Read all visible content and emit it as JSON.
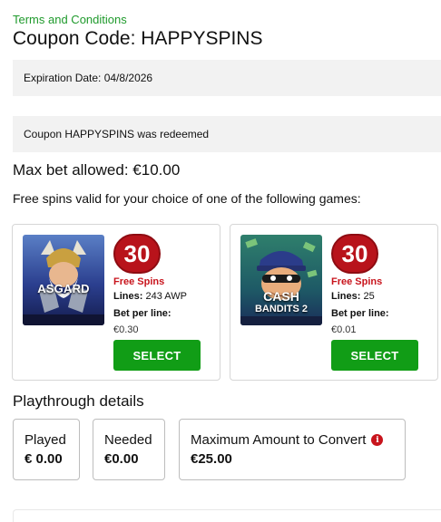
{
  "header": {
    "terms_link": "Terms and Conditions",
    "title": "Coupon Code: HAPPYSPINS"
  },
  "expiration": {
    "text": "Expiration Date: 04/8/2026"
  },
  "redeem_notice": {
    "text": "Coupon HAPPYSPINS was redeemed"
  },
  "max_bet": {
    "text": "Max bet allowed: €10.00"
  },
  "games_intro": "Free spins valid for your choice of one of the following games:",
  "games": [
    {
      "thumb_text": "ASGARD",
      "spins": "30",
      "spins_label": "Free Spins",
      "lines_label": "Lines:",
      "lines_value": "243 AWP",
      "bet_label": "Bet per line:",
      "bet_value": "€0.30",
      "button": "SELECT"
    },
    {
      "thumb_text_1": "CASH",
      "thumb_text_2": "BANDITS 2",
      "spins": "30",
      "spins_label": "Free Spins",
      "lines_label": "Lines:",
      "lines_value": "25",
      "bet_label": "Bet per line:",
      "bet_value": "€0.01",
      "button": "SELECT"
    }
  ],
  "playthrough": {
    "title": "Playthrough details",
    "played_label": "Played",
    "played_value": "€ 0.00",
    "needed_label": "Needed",
    "needed_value": "€0.00",
    "max_label": "Maximum Amount to Convert",
    "max_value": "€25.00"
  },
  "colors": {
    "link_green": "#1f9a2c",
    "button_green": "#119d16",
    "badge_red": "#b8131b",
    "panel_gray": "#f2f2f2"
  },
  "icons": {
    "info": "info-icon"
  }
}
